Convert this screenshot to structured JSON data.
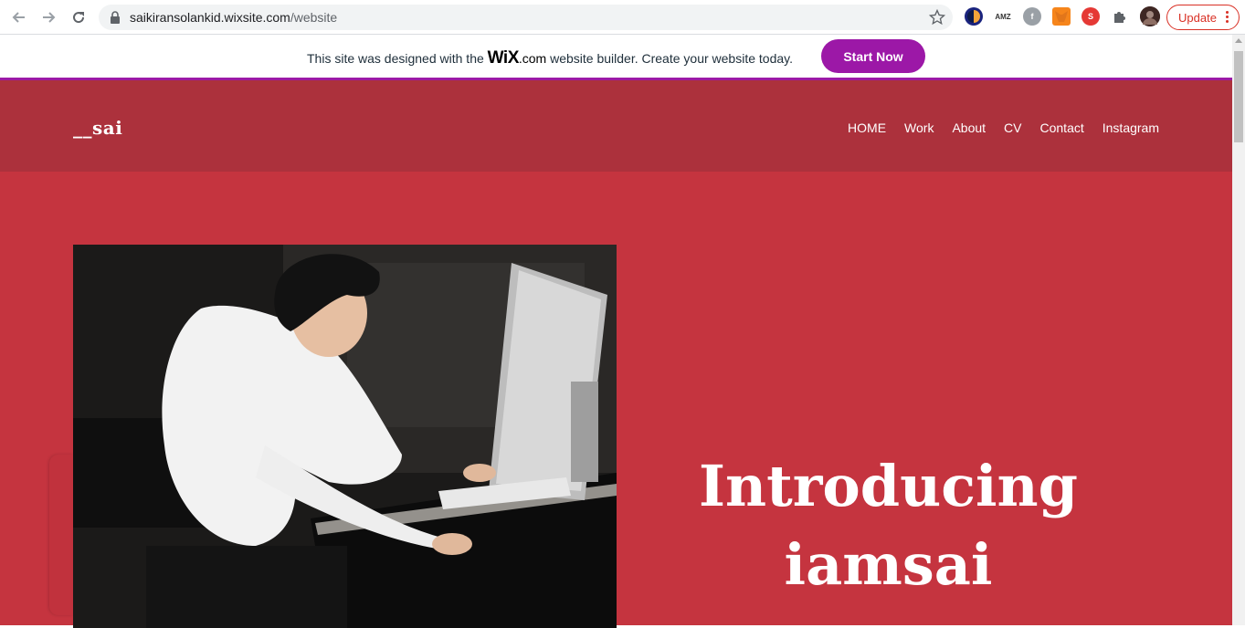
{
  "browser": {
    "url_host": "saikiransolankid.wixsite.com",
    "url_path": "/website",
    "update_label": "Update",
    "extensions": [
      "amz-icon",
      "facebook-icon",
      "metamask-icon",
      "s-extension-icon",
      "puzzle-icon"
    ]
  },
  "wix_banner": {
    "text_before": "This site was designed with the ",
    "wix_logo": "WiX",
    "wix_domain": ".com",
    "text_after": " website builder. Create your website today.",
    "cta_label": "Start Now"
  },
  "site": {
    "logo": "__sai",
    "nav": [
      "HOME",
      "Work",
      "About",
      "CV",
      "Contact",
      "Instagram"
    ],
    "hero_line1": "Introducing",
    "hero_line2": "iamsai"
  },
  "colors": {
    "header_bg": "#ac313c",
    "hero_bg": "#c5343f",
    "cta_bg": "#9c18a7",
    "update_red": "#d93025"
  }
}
